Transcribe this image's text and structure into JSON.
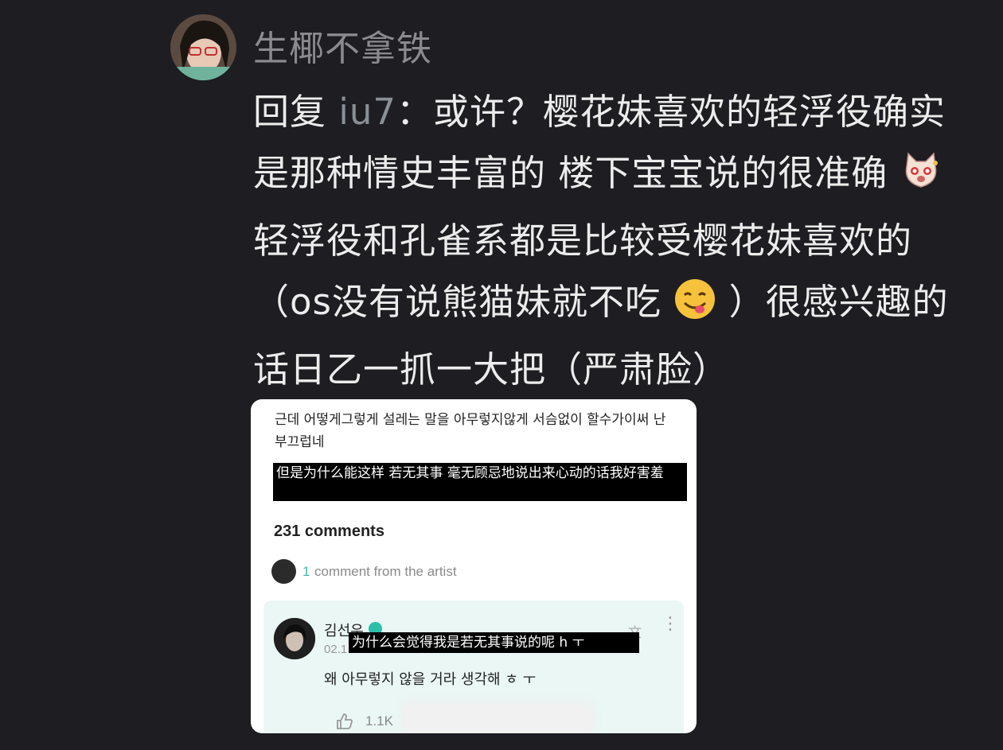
{
  "post": {
    "username": "生椰不拿铁",
    "reply_prefix": "回复",
    "reply_mention": "iu7",
    "reply_colon": "：",
    "reply_text_1": "或许？樱花妹喜欢的轻浮役确实是那种情史丰富的 楼下宝宝说的很准确",
    "reply_text_2": "轻浮役和孔雀系都是比较受樱花妹喜欢的（os没有说熊猫妹就不吃",
    "reply_text_3": "）很感兴趣的话日乙一抓一大把（严肃脸）",
    "emoji_1": "cat-emoji",
    "emoji_2": "yum-emoji"
  },
  "screenshot": {
    "korean_text": "근데 어떻게그렇게 설레는 말을 아무렇지않게 서슴없이 할수가이써 난 부끄럽네",
    "subtitle_1": "但是为什么能这样 若无其事 毫无顾忌地说出来心动的话我好害羞",
    "comments_count": "231 comments",
    "artist_count": "1",
    "artist_label": " comment from the artist",
    "comment": {
      "name": "김선우",
      "date": "02.1",
      "subtitle_2": "为什么会觉得我是若无其事说的呢 h ㅜ",
      "text": "왜 아무렇지 않을 거라 생각해 ㅎ ㅜ",
      "likes": "1.1K",
      "translate_icon": "translate-icon",
      "more_icon": "more-vertical-icon"
    }
  }
}
